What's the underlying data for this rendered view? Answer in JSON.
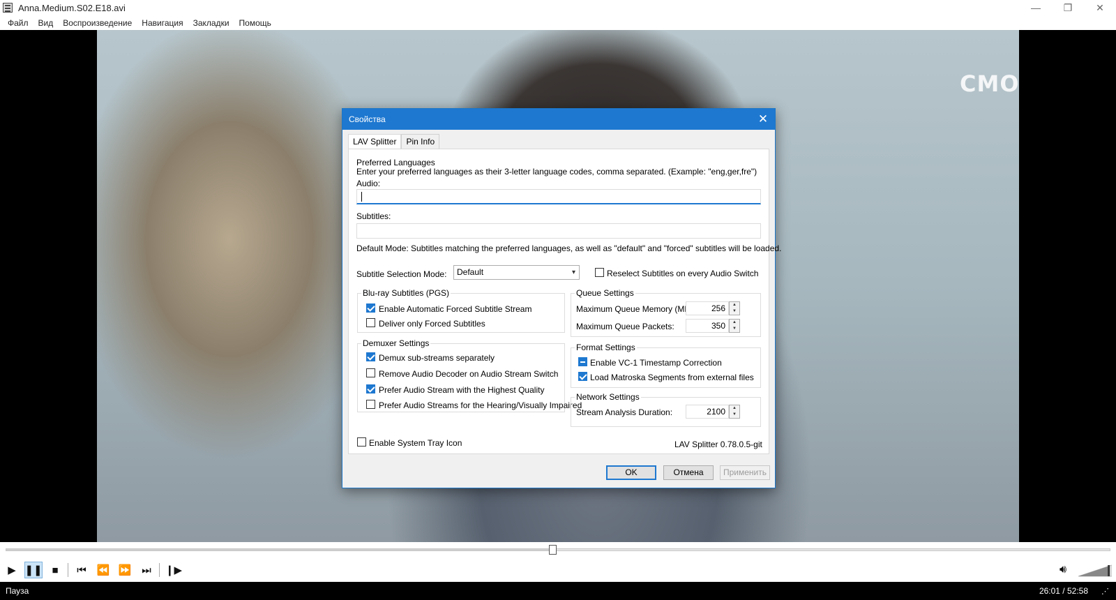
{
  "window": {
    "title": "Anna.Medium.S02.E18.avi",
    "minimize": "—",
    "restore": "❐",
    "close": "✕"
  },
  "menu": [
    "Файл",
    "Вид",
    "Воспроизведение",
    "Навигация",
    "Закладки",
    "Помощь"
  ],
  "video": {
    "watermark": "СМОТРИМ"
  },
  "dialog": {
    "title": "Свойства",
    "close": "✕",
    "tabs": [
      "LAV Splitter",
      "Pin Info"
    ],
    "preferred_languages_label": "Preferred Languages",
    "preferred_languages_hint": "Enter your preferred languages as their 3-letter language codes, comma separated. (Example: \"eng,ger,fre\")",
    "audio_label": "Audio:",
    "audio_value": "",
    "subtitles_label": "Subtitles:",
    "subtitles_value": "",
    "default_mode_text": "Default Mode: Subtitles matching the preferred languages, as well as \"default\" and \"forced\" subtitles will be loaded.",
    "subtitle_selection_mode_label": "Subtitle Selection Mode:",
    "subtitle_selection_mode_value": "Default",
    "reselect_subtitles_label": "Reselect Subtitles on every Audio Switch",
    "reselect_subtitles_checked": false,
    "bluray": {
      "title": "Blu-ray Subtitles (PGS)",
      "items": [
        {
          "label": "Enable Automatic Forced Subtitle Stream",
          "checked": true
        },
        {
          "label": "Deliver only Forced Subtitles",
          "checked": false
        }
      ]
    },
    "demuxer": {
      "title": "Demuxer Settings",
      "items": [
        {
          "label": "Demux sub-streams separately",
          "checked": true
        },
        {
          "label": "Remove Audio Decoder on Audio Stream Switch",
          "checked": false
        },
        {
          "label": "Prefer Audio Stream with the Highest Quality",
          "checked": true
        },
        {
          "label": "Prefer Audio Streams for the Hearing/Visually Impaired",
          "checked": false
        }
      ]
    },
    "queue": {
      "title": "Queue Settings",
      "max_memory_label": "Maximum Queue Memory (MB):",
      "max_memory_value": "256",
      "max_packets_label": "Maximum Queue Packets:",
      "max_packets_value": "350"
    },
    "format": {
      "title": "Format Settings",
      "items": [
        {
          "label": "Enable VC-1 Timestamp Correction",
          "state": "indeterminate"
        },
        {
          "label": "Load Matroska Segments from external files",
          "state": "checked"
        }
      ]
    },
    "network": {
      "title": "Network Settings",
      "analysis_label": "Stream Analysis Duration:",
      "analysis_value": "2100"
    },
    "system_tray_label": "Enable System Tray Icon",
    "system_tray_checked": false,
    "version": "LAV Splitter 0.78.0.5-git",
    "buttons": {
      "ok": "OK",
      "cancel": "Отмена",
      "apply": "Применить"
    }
  },
  "player": {
    "progress_fraction": 0.495,
    "status": "Пауза",
    "time": "26:01 / 52:58",
    "volume_fraction": 0.9
  },
  "icons": [
    "play-icon",
    "pause-icon",
    "stop-icon",
    "skip-back-icon",
    "rewind-icon",
    "fast-forward-icon",
    "skip-forward-icon",
    "frame-step-icon",
    "volume-icon"
  ],
  "colors": {
    "accent": "#1e78d0",
    "dialog_bg": "#f0f0f0",
    "statusbar": "#000000"
  }
}
